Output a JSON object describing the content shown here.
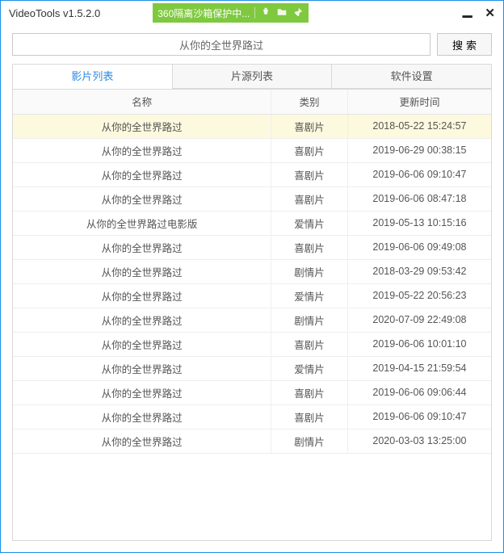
{
  "titlebar": {
    "title": "VideoTools v1.5.2.0",
    "sandbox_label": "360隔离沙箱保护中..."
  },
  "search": {
    "value": "从你的全世界路过",
    "button": "搜索"
  },
  "tabs": {
    "items": [
      {
        "label": "影片列表"
      },
      {
        "label": "片源列表"
      },
      {
        "label": "软件设置"
      }
    ]
  },
  "table": {
    "headers": {
      "name": "名称",
      "type": "类别",
      "time": "更新时间"
    },
    "rows": [
      {
        "name": "从你的全世界路过",
        "type": "喜剧片",
        "time": "2018-05-22 15:24:57",
        "selected": true
      },
      {
        "name": "从你的全世界路过",
        "type": "喜剧片",
        "time": "2019-06-29 00:38:15"
      },
      {
        "name": "从你的全世界路过",
        "type": "喜剧片",
        "time": "2019-06-06 09:10:47"
      },
      {
        "name": "从你的全世界路过",
        "type": "喜剧片",
        "time": "2019-06-06 08:47:18"
      },
      {
        "name": "从你的全世界路过电影版",
        "type": "爱情片",
        "time": "2019-05-13 10:15:16"
      },
      {
        "name": "从你的全世界路过",
        "type": "喜剧片",
        "time": "2019-06-06 09:49:08"
      },
      {
        "name": "从你的全世界路过",
        "type": "剧情片",
        "time": "2018-03-29 09:53:42"
      },
      {
        "name": "从你的全世界路过",
        "type": "爱情片",
        "time": "2019-05-22 20:56:23"
      },
      {
        "name": "从你的全世界路过",
        "type": "剧情片",
        "time": "2020-07-09 22:49:08"
      },
      {
        "name": "从你的全世界路过",
        "type": "喜剧片",
        "time": "2019-06-06 10:01:10"
      },
      {
        "name": "从你的全世界路过",
        "type": "爱情片",
        "time": "2019-04-15 21:59:54"
      },
      {
        "name": "从你的全世界路过",
        "type": "喜剧片",
        "time": "2019-06-06 09:06:44"
      },
      {
        "name": "从你的全世界路过",
        "type": "喜剧片",
        "time": "2019-06-06 09:10:47"
      },
      {
        "name": "从你的全世界路过",
        "type": "剧情片",
        "time": "2020-03-03 13:25:00"
      }
    ]
  }
}
